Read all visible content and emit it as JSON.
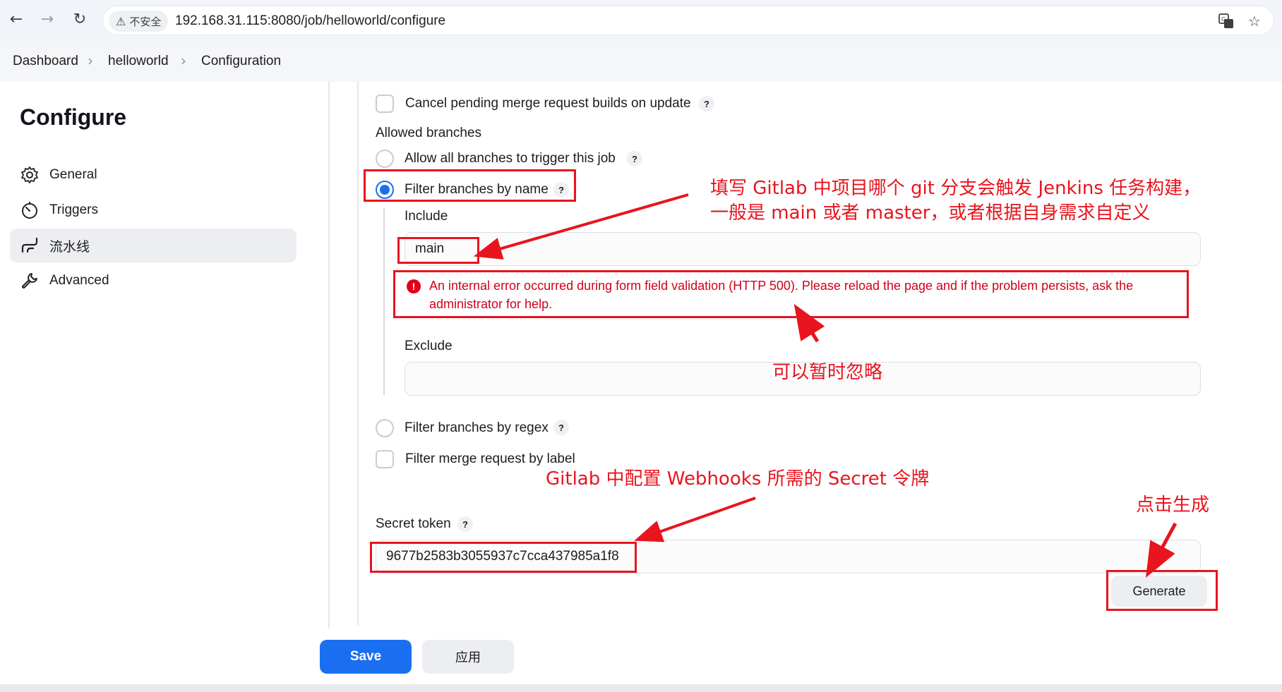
{
  "browser": {
    "security_label": "不安全",
    "url": "192.168.31.115:8080/job/helloworld/configure"
  },
  "breadcrumb": [
    "Dashboard",
    "helloworld",
    "Configuration"
  ],
  "sidebar": {
    "title": "Configure",
    "items": [
      {
        "label": "General",
        "icon": "gear-icon"
      },
      {
        "label": "Triggers",
        "icon": "stopwatch-icon"
      },
      {
        "label": "流水线",
        "icon": "pipeline-icon",
        "active": true
      },
      {
        "label": "Advanced",
        "icon": "wrench-icon"
      }
    ]
  },
  "form": {
    "cancel_pending_label": "Cancel pending merge request builds on update",
    "allowed_branches_label": "Allowed branches",
    "allow_all_label": "Allow all branches to trigger this job",
    "filter_by_name_label": "Filter branches by name",
    "include_label": "Include",
    "include_value": "main",
    "error_text": "An internal error occurred during form field validation (HTTP 500). Please reload the page and if the problem persists, ask the administrator for help.",
    "exclude_label": "Exclude",
    "exclude_value": "",
    "filter_by_regex_label": "Filter branches by regex",
    "filter_mr_label": "Filter merge request by label",
    "secret_token_label": "Secret token",
    "secret_token_value": "9677b2583b3055937c7cca437985a1f8",
    "help_symbol": "?",
    "generate_label": "Generate"
  },
  "actions": {
    "save_label": "Save",
    "apply_label": "应用"
  },
  "annotations": {
    "branch_note_line1": "填写 Gitlab 中项目哪个 git 分支会触发 Jenkins 任务构建，",
    "branch_note_line2": "一般是 main 或者 master，或者根据自身需求自定义",
    "ignore_note": "可以暂时忽略",
    "secret_note": "Gitlab 中配置 Webhooks 所需的 Secret 令牌",
    "generate_note": "点击生成"
  },
  "colors": {
    "accent": "#1a6ff0",
    "error": "#d0021b",
    "annotation": "#e8141e"
  }
}
